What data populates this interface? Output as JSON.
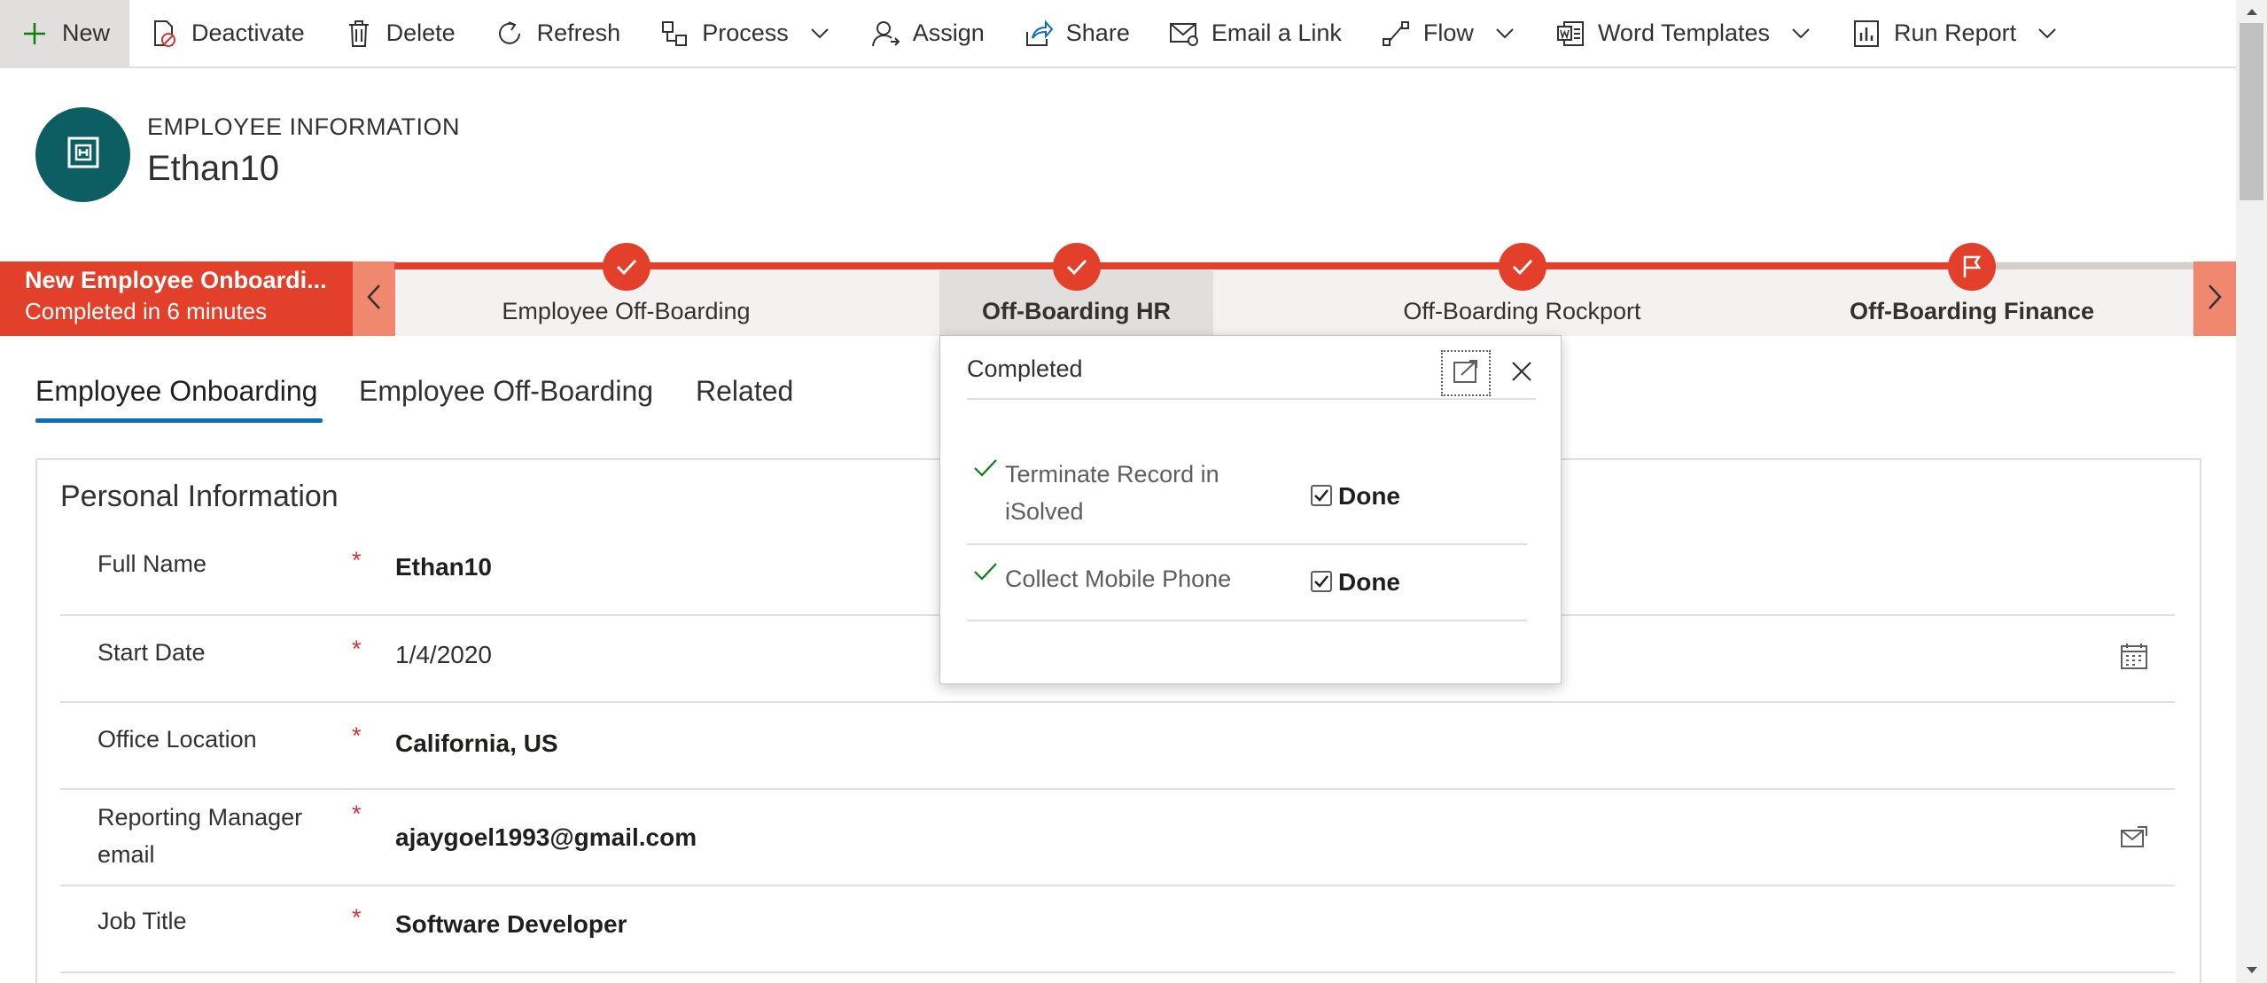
{
  "command_bar": {
    "items": [
      {
        "label": "New",
        "icon": "plus-icon"
      },
      {
        "label": "Deactivate",
        "icon": "deactivate-icon"
      },
      {
        "label": "Delete",
        "icon": "trash-icon"
      },
      {
        "label": "Refresh",
        "icon": "refresh-icon"
      },
      {
        "label": "Process",
        "icon": "process-icon",
        "dropdown": true
      },
      {
        "label": "Assign",
        "icon": "person-icon"
      },
      {
        "label": "Share",
        "icon": "share-icon"
      },
      {
        "label": "Email a Link",
        "icon": "email-link-icon"
      },
      {
        "label": "Flow",
        "icon": "flow-icon",
        "dropdown": true
      },
      {
        "label": "Word Templates",
        "icon": "word-icon",
        "dropdown": true
      },
      {
        "label": "Run Report",
        "icon": "report-icon",
        "dropdown": true
      }
    ]
  },
  "header": {
    "entity_type": "EMPLOYEE INFORMATION",
    "record_name": "Ethan10"
  },
  "process_bar": {
    "active_process": "New Employee Onboardi...",
    "active_status": "Completed in 6 minutes",
    "stages": [
      {
        "label": "Employee Off-Boarding",
        "status": "completed"
      },
      {
        "label": "Off-Boarding HR",
        "status": "completed",
        "selected": true
      },
      {
        "label": "Off-Boarding Rockport",
        "status": "completed"
      },
      {
        "label": "Off-Boarding Finance",
        "status": "active"
      }
    ]
  },
  "flyout": {
    "title": "Completed",
    "steps": [
      {
        "label": "Terminate Record in iSolved",
        "value": "Done",
        "checked": true
      },
      {
        "label": "Collect Mobile Phone",
        "value": "Done",
        "checked": true
      }
    ]
  },
  "tabs": [
    {
      "label": "Employee Onboarding",
      "active": true
    },
    {
      "label": "Employee Off-Boarding"
    },
    {
      "label": "Related"
    }
  ],
  "section": {
    "title": "Personal Information",
    "fields": [
      {
        "label": "Full Name",
        "required": "*",
        "value": "Ethan10"
      },
      {
        "label": "Start Date",
        "required": "*",
        "value": "1/4/2020"
      },
      {
        "label": "Office Location",
        "required": "*",
        "value": "California, US"
      },
      {
        "label": "Reporting Manager email",
        "required": "*",
        "value": "ajaygoel1993@gmail.com"
      },
      {
        "label": "Job Title",
        "required": "*",
        "value": "Software Developer"
      }
    ]
  },
  "colors": {
    "accent_red": "#e2402a",
    "accent_blue": "#0f6cbd",
    "avatar_teal": "#0c5e63"
  }
}
